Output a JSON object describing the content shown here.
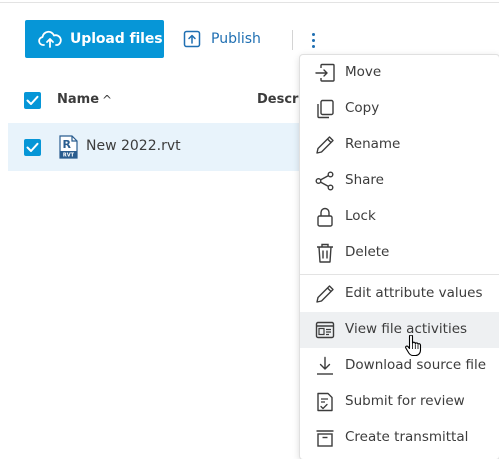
{
  "toolbar": {
    "upload_label": "Upload files",
    "publish_label": "Publish"
  },
  "table": {
    "columns": [
      "Name",
      "Descrip"
    ],
    "sort_indicator": "^",
    "rows": [
      {
        "name": "New 2022.rvt",
        "type_badge": "RVT",
        "selected": true
      }
    ]
  },
  "context_menu": {
    "items": [
      {
        "label": "Move",
        "icon": "move-icon"
      },
      {
        "label": "Copy",
        "icon": "copy-icon"
      },
      {
        "label": "Rename",
        "icon": "pencil-icon"
      },
      {
        "label": "Share",
        "icon": "share-icon"
      },
      {
        "label": "Lock",
        "icon": "lock-icon"
      },
      {
        "label": "Delete",
        "icon": "trash-icon"
      },
      {
        "label": "Edit attribute values",
        "icon": "pencil-icon"
      },
      {
        "label": "View file activities",
        "icon": "activity-icon",
        "hovered": true
      },
      {
        "label": "Download source file",
        "icon": "download-icon"
      },
      {
        "label": "Submit for review",
        "icon": "review-icon"
      },
      {
        "label": "Create transmittal",
        "icon": "transmittal-icon"
      }
    ]
  },
  "colors": {
    "primary": "#0696d7",
    "link": "#1f6fb2",
    "row_selected": "#e8f3fb",
    "menu_hover": "#eef0f2"
  }
}
